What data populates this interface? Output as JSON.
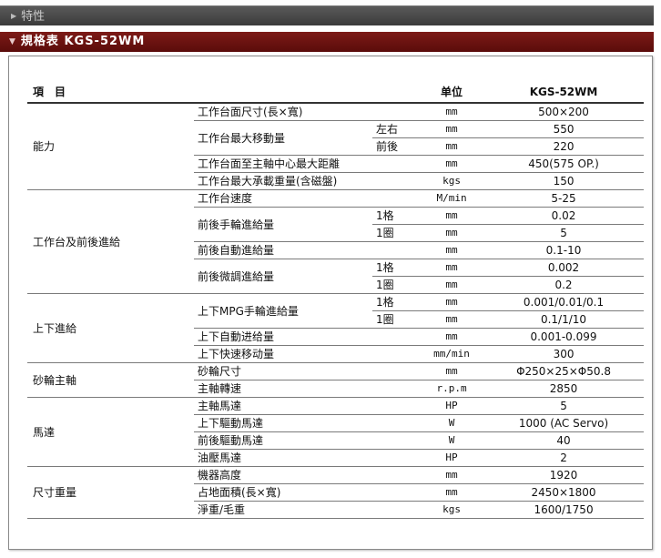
{
  "section_collapsed": {
    "label": "特性"
  },
  "section_open": {
    "label": "規格表 KGS-52WM"
  },
  "table": {
    "headers": {
      "item": "項　目",
      "unit": "单位",
      "model": "KGS-52WM"
    },
    "rows": [
      {
        "cat": "能力",
        "span": 5,
        "item": "工作台面尺寸(長×寬)",
        "isp": 1,
        "unit": "mm",
        "value": "500×200"
      },
      {
        "item": "工作台最大移動量",
        "isp": 2,
        "sub": "左右",
        "unit": "mm",
        "value": "550"
      },
      {
        "sub": "前後",
        "unit": "mm",
        "value": "220"
      },
      {
        "item": "工作台面至主軸中心最大距離",
        "isp": 1,
        "unit": "mm",
        "value": "450(575 OP.)"
      },
      {
        "item": "工作台最大承載重量(含磁盤)",
        "isp": 1,
        "unit": "kgs",
        "value": "150"
      },
      {
        "cat": "工作台及前後進給",
        "span": 6,
        "item": "工作台速度",
        "isp": 1,
        "unit": "M/min",
        "value": "5-25"
      },
      {
        "item": "前後手輪進給量",
        "isp": 2,
        "sub": "1格",
        "unit": "mm",
        "value": "0.02"
      },
      {
        "sub": "1圈",
        "unit": "mm",
        "value": "5"
      },
      {
        "item": "前後自動進給量",
        "isp": 1,
        "unit": "mm",
        "value": "0.1-10"
      },
      {
        "item": "前後微調進給量",
        "isp": 2,
        "sub": "1格",
        "unit": "mm",
        "value": "0.002"
      },
      {
        "sub": "1圈",
        "unit": "mm",
        "value": "0.2"
      },
      {
        "cat": "上下進給",
        "span": 4,
        "item": "上下MPG手輪進給量",
        "isp": 2,
        "sub": "1格",
        "unit": "mm",
        "value": "0.001/0.01/0.1"
      },
      {
        "sub": "1圈",
        "unit": "mm",
        "value": "0.1/1/10"
      },
      {
        "item": "上下自動进给量",
        "isp": 1,
        "unit": "mm",
        "value": "0.001-0.099"
      },
      {
        "item": "上下快速移动量",
        "isp": 1,
        "unit": "mm/min",
        "value": "300"
      },
      {
        "cat": "砂輪主軸",
        "span": 2,
        "item": "砂輪尺寸",
        "isp": 1,
        "unit": "mm",
        "value": "Φ250×25×Φ50.8"
      },
      {
        "item": "主軸轉速",
        "isp": 1,
        "unit": "r.p.m",
        "value": "2850"
      },
      {
        "cat": "馬達",
        "span": 4,
        "item": "主軸馬達",
        "isp": 1,
        "unit": "HP",
        "value": "5"
      },
      {
        "item": "上下驅動馬達",
        "isp": 1,
        "unit": "W",
        "value": "1000 (AC Servo)"
      },
      {
        "item": "前後驅動馬達",
        "isp": 1,
        "unit": "W",
        "value": "40"
      },
      {
        "item": "油壓馬達",
        "isp": 1,
        "unit": "HP",
        "value": "2"
      },
      {
        "cat": "尺寸重量",
        "span": 3,
        "item": "機器高度",
        "isp": 1,
        "unit": "mm",
        "value": "1920"
      },
      {
        "item": "占地面積(長×寬)",
        "isp": 1,
        "unit": "mm",
        "value": "2450×1800"
      },
      {
        "item": "淨重/毛重",
        "isp": 1,
        "unit": "kgs",
        "value": "1600/1750"
      }
    ]
  }
}
